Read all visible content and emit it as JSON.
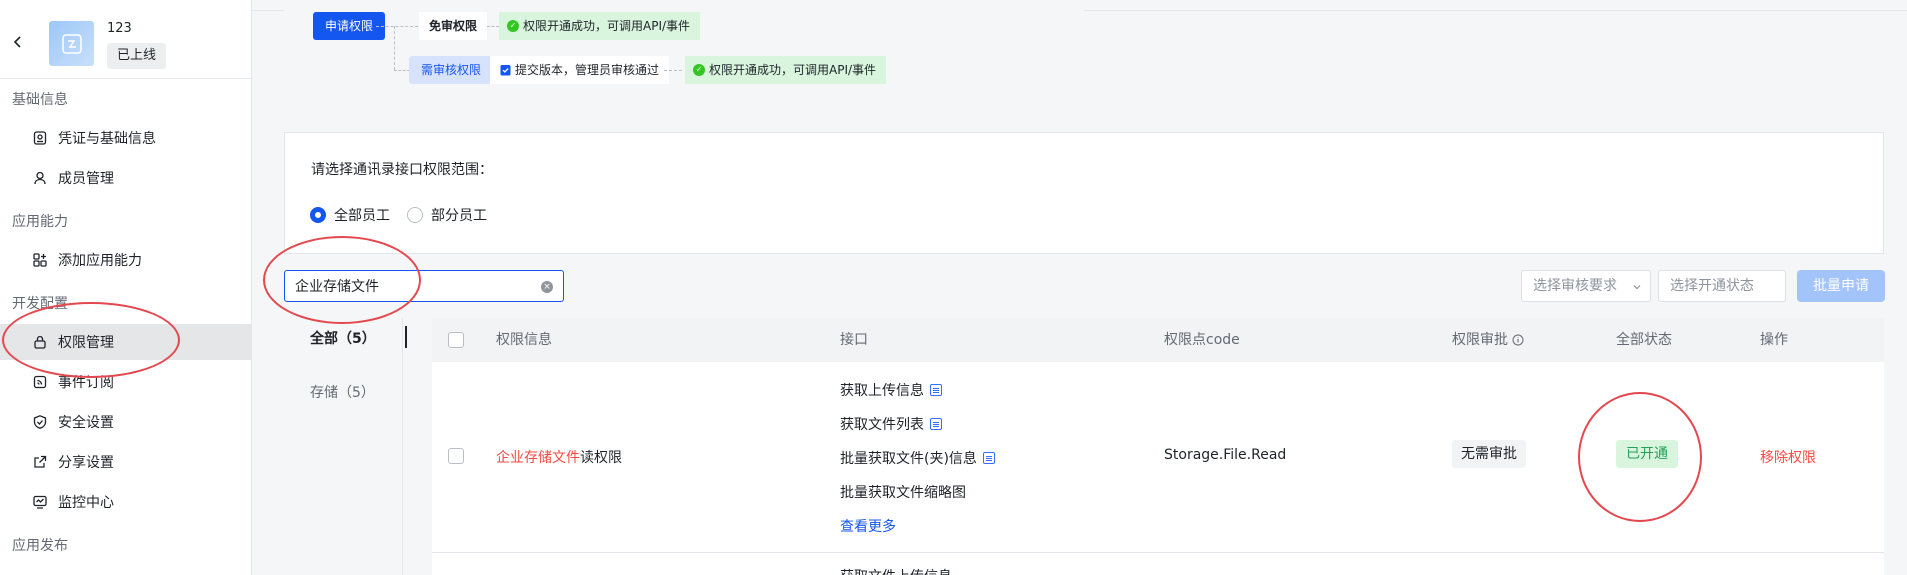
{
  "app": {
    "name": "123",
    "status": "已上线"
  },
  "sidebar": {
    "groups": [
      {
        "title": "基础信息",
        "items": [
          {
            "label": "凭证与基础信息",
            "icon": "credential-icon"
          },
          {
            "label": "成员管理",
            "icon": "member-icon"
          }
        ]
      },
      {
        "title": "应用能力",
        "items": [
          {
            "label": "添加应用能力",
            "icon": "add-capability-icon"
          }
        ]
      },
      {
        "title": "开发配置",
        "items": [
          {
            "label": "权限管理",
            "icon": "lock-icon",
            "active": true
          },
          {
            "label": "事件订阅",
            "icon": "rss-icon"
          },
          {
            "label": "安全设置",
            "icon": "shield-icon"
          },
          {
            "label": "分享设置",
            "icon": "share-icon"
          },
          {
            "label": "监控中心",
            "icon": "monitor-icon"
          }
        ]
      },
      {
        "title": "应用发布",
        "items": []
      }
    ]
  },
  "flow": {
    "apply_label": "申请权限",
    "no_review_label": "免审权限",
    "review_label": "需审核权限",
    "success_text_1": "权限开通成功，可调用API/事件",
    "submit_text": "提交版本，管理员审核通过",
    "success_text_2": "权限开通成功，可调用API/事件"
  },
  "scope": {
    "title": "请选择通讯录接口权限范围：",
    "options": [
      "全部员工",
      "部分员工"
    ],
    "selected": "全部员工"
  },
  "filters": {
    "search_value": "企业存储文件",
    "review_placeholder": "选择审核要求",
    "status_placeholder": "选择开通状态",
    "batch_label": "批量申请"
  },
  "categories": [
    {
      "label": "全部（5）",
      "active": true
    },
    {
      "label": "存储（5）",
      "active": false
    }
  ],
  "table": {
    "headers": {
      "info": "权限信息",
      "api": "接口",
      "code": "权限点code",
      "review": "权限审批",
      "status": "全部状态",
      "action": "操作"
    },
    "rows": [
      {
        "name_highlight": "企业存储文件",
        "name_rest": "读权限",
        "apis": [
          "获取上传信息",
          "获取文件列表",
          "批量获取文件(夹)信息",
          "批量获取文件缩略图"
        ],
        "api_more": "查看更多",
        "code": "Storage.File.Read",
        "review": "无需审批",
        "status": "已开通",
        "action": "移除权限"
      }
    ],
    "next_row_partial": "获取文件上传信息"
  },
  "colors": {
    "primary": "#1456f0",
    "highlight": "#f54a45",
    "action": "#f54a45",
    "success_bg": "#d9f5dd",
    "success_text": "#24a05a",
    "annotation_ring": "#e3484e"
  }
}
